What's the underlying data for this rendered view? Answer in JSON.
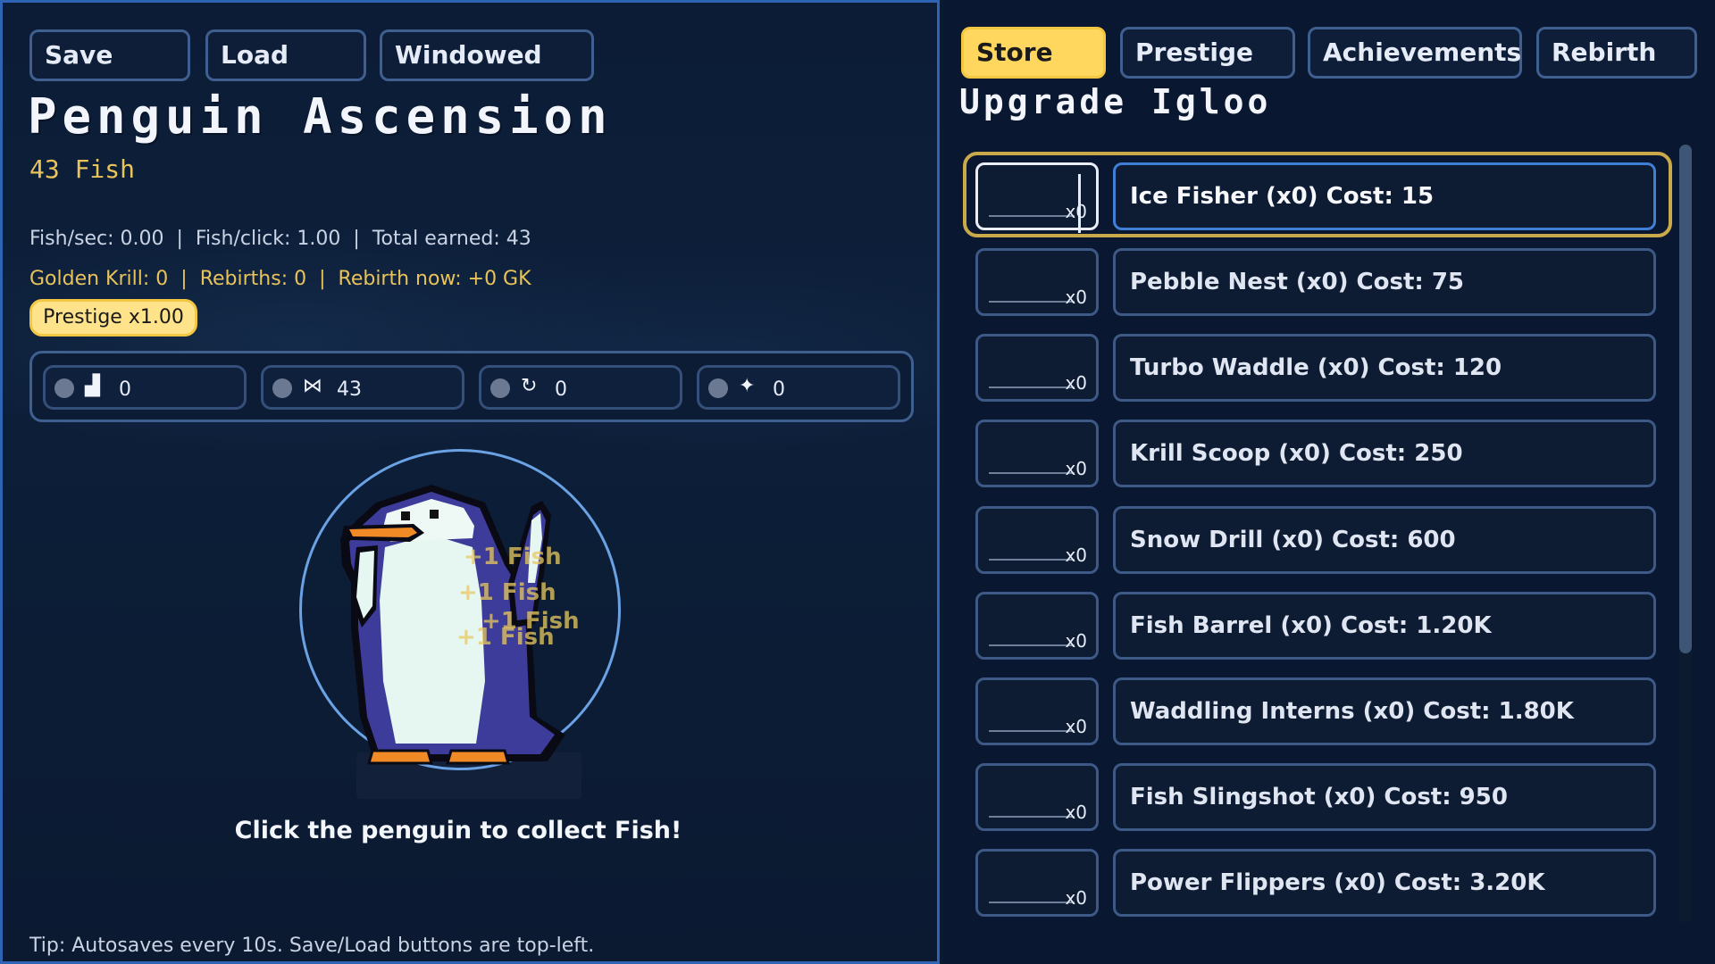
{
  "left_panel": {
    "buttons": {
      "save": "Save",
      "load": "Load",
      "windowed": "Windowed"
    },
    "title": "Penguin Ascension",
    "fish_count": "43 Fish",
    "stats": {
      "fish_per_sec": "Fish/sec: 0.00",
      "fish_per_click": "Fish/click: 1.00",
      "total_earned": "Total earned: 43",
      "golden_krill": "Golden Krill: 0",
      "rebirths": "Rebirths: 0",
      "rebirth_now": "Rebirth now: +0 GK",
      "separator": "|"
    },
    "prestige_badge": "Prestige x1.00",
    "resources": [
      {
        "icon": "boot-icon",
        "glyph": "▟",
        "value": "0"
      },
      {
        "icon": "fish-icon",
        "glyph": "⋈",
        "value": "43"
      },
      {
        "icon": "refresh-icon",
        "glyph": "↻",
        "value": "0"
      },
      {
        "icon": "sparkle-icon",
        "glyph": "✦",
        "value": "0"
      }
    ],
    "floating_text": [
      "+1 Fish",
      "+1 Fish",
      "+1 Fish",
      "+1 Fish"
    ],
    "hint": "Click the penguin to collect Fish!",
    "tip": "Tip: Autosaves every 10s. Save/Load buttons are top-left."
  },
  "right_panel": {
    "tabs": [
      "Store",
      "Prestige",
      "Achievements",
      "Rebirth"
    ],
    "active_tab": "Store",
    "section_title": "Upgrade Igloo",
    "qty_suffix": "x0",
    "items": [
      {
        "label": "Ice Fisher  (x0)  Cost: 15"
      },
      {
        "label": "Pebble Nest  (x0)  Cost: 75"
      },
      {
        "label": "Turbo Waddle  (x0)  Cost: 120"
      },
      {
        "label": "Krill Scoop  (x0)  Cost: 250"
      },
      {
        "label": "Snow Drill  (x0)  Cost: 600"
      },
      {
        "label": "Fish Barrel  (x0)  Cost: 1.20K"
      },
      {
        "label": "Waddling Interns  (x0)  Cost: 1.80K"
      },
      {
        "label": "Fish Slingshot  (x0)  Cost: 950"
      },
      {
        "label": "Power Flippers  (x0)  Cost: 3.20K"
      }
    ]
  },
  "colors": {
    "accent_gold": "#ffd75e",
    "text_gold": "#e8c35a",
    "panel_border": "#2f63b4",
    "background": "#0b1a31"
  }
}
